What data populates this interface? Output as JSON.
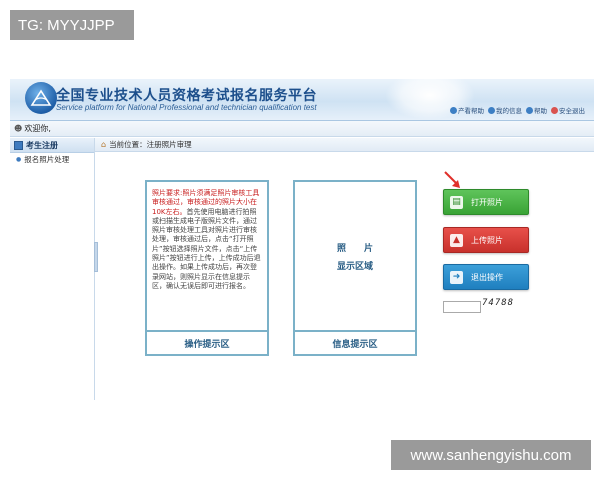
{
  "badge": {
    "text": "TG: MYYJJPP"
  },
  "header": {
    "title": "全国专业技术人员资格考试报名服务平台",
    "subtitle": "Service platform for National Professional and technician qualification test",
    "links": [
      {
        "label": "产看帮助",
        "icon": "help-icon"
      },
      {
        "label": "我的信息",
        "icon": "user-info-icon"
      },
      {
        "label": "帮助",
        "icon": "help-circle-icon"
      },
      {
        "label": "安全退出",
        "icon": "power-icon"
      }
    ]
  },
  "userbar": {
    "name": "欢迎你,"
  },
  "sidebar": {
    "section_title": "考生注册",
    "items": [
      {
        "label": "报名照片处理"
      }
    ]
  },
  "breadcrumb": {
    "text": "当前位置：注册照片审理"
  },
  "ops_panel": {
    "footer": "操作提示区",
    "text_red": "照片要求:照片须满足照片审核工具审核通过，审核通过的照片大小在10K左右。",
    "text_body": "首先使用电脑进行拍照或扫描生成电子版照片文件，通过照片审核处理工具对照片进行审核处理，审核通过后，点击“打开照片”按钮选择照片文件，点击“上传照片”按钮进行上传，上传成功后退出操作。如果上传成功后，再次登录网站，则照片显示在信息提示区，确认无误后即可进行报名。"
  },
  "info_panel": {
    "footer": "信息提示区",
    "photo_label": "照　　片",
    "display_label": "显示区域"
  },
  "actions": {
    "open_photo": "打开照片",
    "upload_photo": "上传照片",
    "exit": "退出操作"
  },
  "captcha": {
    "code": "74788"
  },
  "watermark": {
    "text": "www.sanhengyishu.com"
  },
  "colors": {
    "accent": "#1d4f8c",
    "panel_border": "#7bb1c8",
    "green": "#39a335",
    "red": "#c8312c",
    "blue": "#1f7fbf",
    "warning_text": "#c81e1e"
  }
}
